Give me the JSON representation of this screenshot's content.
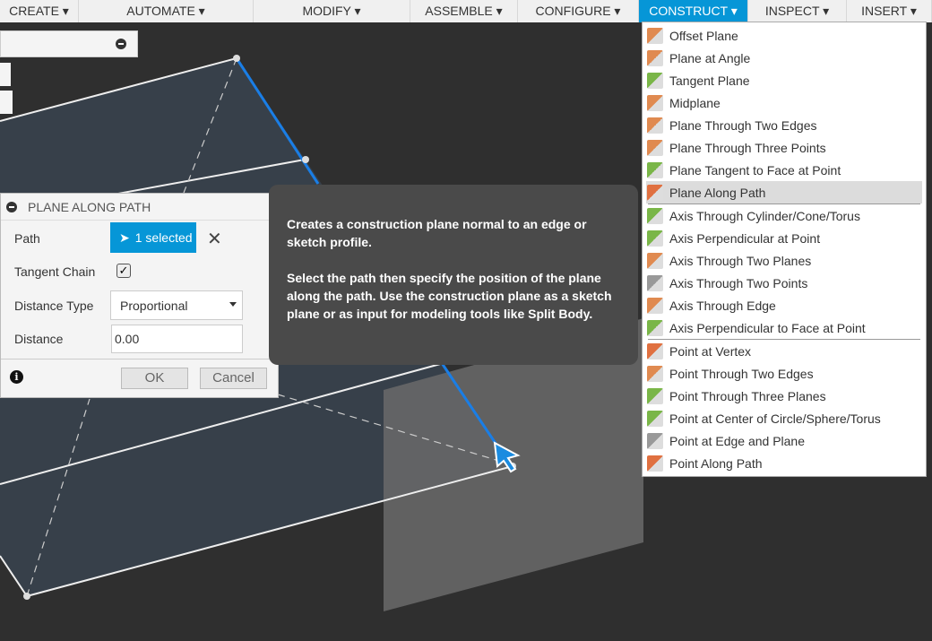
{
  "toolbar": [
    {
      "label": "CREATE ▾",
      "w": 88
    },
    {
      "label": "AUTOMATE ▾",
      "w": 195
    },
    {
      "label": "MODIFY ▾",
      "w": 175
    },
    {
      "label": "ASSEMBLE ▾",
      "w": 120
    },
    {
      "label": "CONFIGURE ▾",
      "w": 135
    },
    {
      "label": "CONSTRUCT ▾",
      "w": 122,
      "active": true
    },
    {
      "label": "INSPECT ▾",
      "w": 110
    },
    {
      "label": "INSERT ▾",
      "w": 95
    }
  ],
  "dialog": {
    "title": "PLANE ALONG PATH",
    "path_label": "Path",
    "path_value": "1 selected",
    "tangent_label": "Tangent Chain",
    "tangent_checked": true,
    "dtype_label": "Distance Type",
    "dtype_value": "Proportional",
    "distance_label": "Distance",
    "distance_value": "0.00",
    "ok": "OK",
    "cancel": "Cancel"
  },
  "tooltip": {
    "p1": "Creates a construction plane normal to an edge or sketch profile.",
    "p2": "Select the path then specify the position of the plane along the path. Use the construction plane as a sketch plane or as input for modeling tools like Split Body."
  },
  "menu": {
    "groups": [
      [
        {
          "label": "Offset Plane",
          "color": "#e08a50"
        },
        {
          "label": "Plane at Angle",
          "color": "#e08a50"
        },
        {
          "label": "Tangent Plane",
          "color": "#7ab648"
        },
        {
          "label": "Midplane",
          "color": "#e08a50"
        },
        {
          "label": "Plane Through Two Edges",
          "color": "#e08a50"
        },
        {
          "label": "Plane Through Three Points",
          "color": "#e08a50"
        },
        {
          "label": "Plane Tangent to Face at Point",
          "color": "#7ab648"
        },
        {
          "label": "Plane Along Path",
          "color": "#e07040",
          "highlighted": true
        }
      ],
      [
        {
          "label": "Axis Through Cylinder/Cone/Torus",
          "color": "#7ab648"
        },
        {
          "label": "Axis Perpendicular at Point",
          "color": "#7ab648"
        },
        {
          "label": "Axis Through Two Planes",
          "color": "#e08a50"
        },
        {
          "label": "Axis Through Two Points",
          "color": "#999999"
        },
        {
          "label": "Axis Through Edge",
          "color": "#e08a50"
        },
        {
          "label": "Axis Perpendicular to Face at Point",
          "color": "#7ab648"
        }
      ],
      [
        {
          "label": "Point at Vertex",
          "color": "#e07040"
        },
        {
          "label": "Point Through Two Edges",
          "color": "#e08a50"
        },
        {
          "label": "Point Through Three Planes",
          "color": "#7ab648"
        },
        {
          "label": "Point at Center of Circle/Sphere/Torus",
          "color": "#7ab648"
        },
        {
          "label": "Point at Edge and Plane",
          "color": "#999999"
        },
        {
          "label": "Point Along Path",
          "color": "#e07040"
        }
      ]
    ]
  }
}
